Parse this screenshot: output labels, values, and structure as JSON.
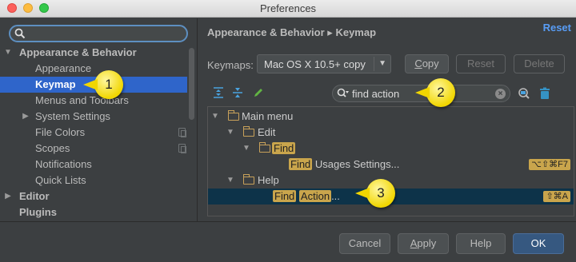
{
  "window": {
    "title": "Preferences"
  },
  "sidebar": {
    "search": {
      "placeholder": ""
    },
    "items": [
      {
        "label": "Appearance & Behavior",
        "expanded": true
      },
      {
        "label": "Appearance"
      },
      {
        "label": "Keymap",
        "selected": true
      },
      {
        "label": "Menus and Toolbars"
      },
      {
        "label": "System Settings"
      },
      {
        "label": "File Colors"
      },
      {
        "label": "Scopes"
      },
      {
        "label": "Notifications"
      },
      {
        "label": "Quick Lists"
      },
      {
        "label": "Editor"
      },
      {
        "label": "Plugins"
      }
    ]
  },
  "header": {
    "breadcrumb_parent": "Appearance & Behavior",
    "breadcrumb_sep": "▸",
    "breadcrumb_child": "Keymap",
    "reset_link": "Reset"
  },
  "keymap": {
    "label": "Keymaps:",
    "selected": "Mac OS X 10.5+ copy",
    "copy_button_label": "Copy",
    "copy_button_mnemonic": "C",
    "reset_button": "Reset",
    "delete_button": "Delete"
  },
  "filter": {
    "value": "find action"
  },
  "tree": {
    "main_menu": "Main menu",
    "edit": "Edit",
    "find": "Find",
    "find_usages_hl": "Find",
    "find_usages_rest": " Usages Settings...",
    "find_usages_shortcut": "⌥⇧⌘F7",
    "help": "Help",
    "find_action_hl1": "Find",
    "find_action_hl2": "Action",
    "find_action_rest": "...",
    "find_action_shortcut": "⇧⌘A"
  },
  "callouts": [
    "1",
    "2",
    "3"
  ],
  "footer": {
    "cancel": "Cancel",
    "apply": "Apply",
    "apply_mnemonic": "A",
    "apply_rest": "pply",
    "help": "Help",
    "ok": "OK"
  },
  "colors": {
    "selection": "#2f65ca",
    "highlight": "#c9a54c",
    "callout": "#f1d600",
    "link": "#589df6"
  }
}
